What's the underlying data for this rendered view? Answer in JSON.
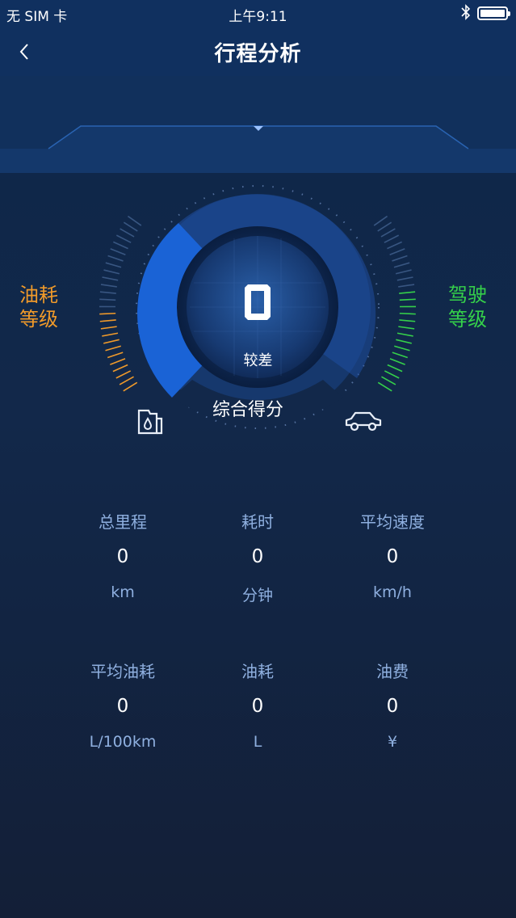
{
  "status_bar": {
    "carrier": "无 SIM 卡",
    "time": "上午9:11",
    "bluetooth_icon": "bluetooth-icon",
    "battery_level": 1.0
  },
  "nav": {
    "title": "行程分析",
    "back_icon": "chevron-left-icon"
  },
  "gauge": {
    "score": "0",
    "status": "较差",
    "title": "综合得分",
    "fuel_level_label": "油耗\n等级",
    "drive_level_label": "驾驶\n等级",
    "fuel_color": "#f09a2a",
    "drive_color": "#35d04a",
    "accent": "#1a63d6"
  },
  "stats": {
    "row1": [
      {
        "label": "总里程",
        "value": "0",
        "unit": "km"
      },
      {
        "label": "耗时",
        "value": "0",
        "unit": "分钟"
      },
      {
        "label": "平均速度",
        "value": "0",
        "unit": "km/h"
      }
    ],
    "row2": [
      {
        "label": "平均油耗",
        "value": "0",
        "unit": "L/100km"
      },
      {
        "label": "油耗",
        "value": "0",
        "unit": "L"
      },
      {
        "label": "油费",
        "value": "0",
        "unit": "¥"
      }
    ]
  }
}
